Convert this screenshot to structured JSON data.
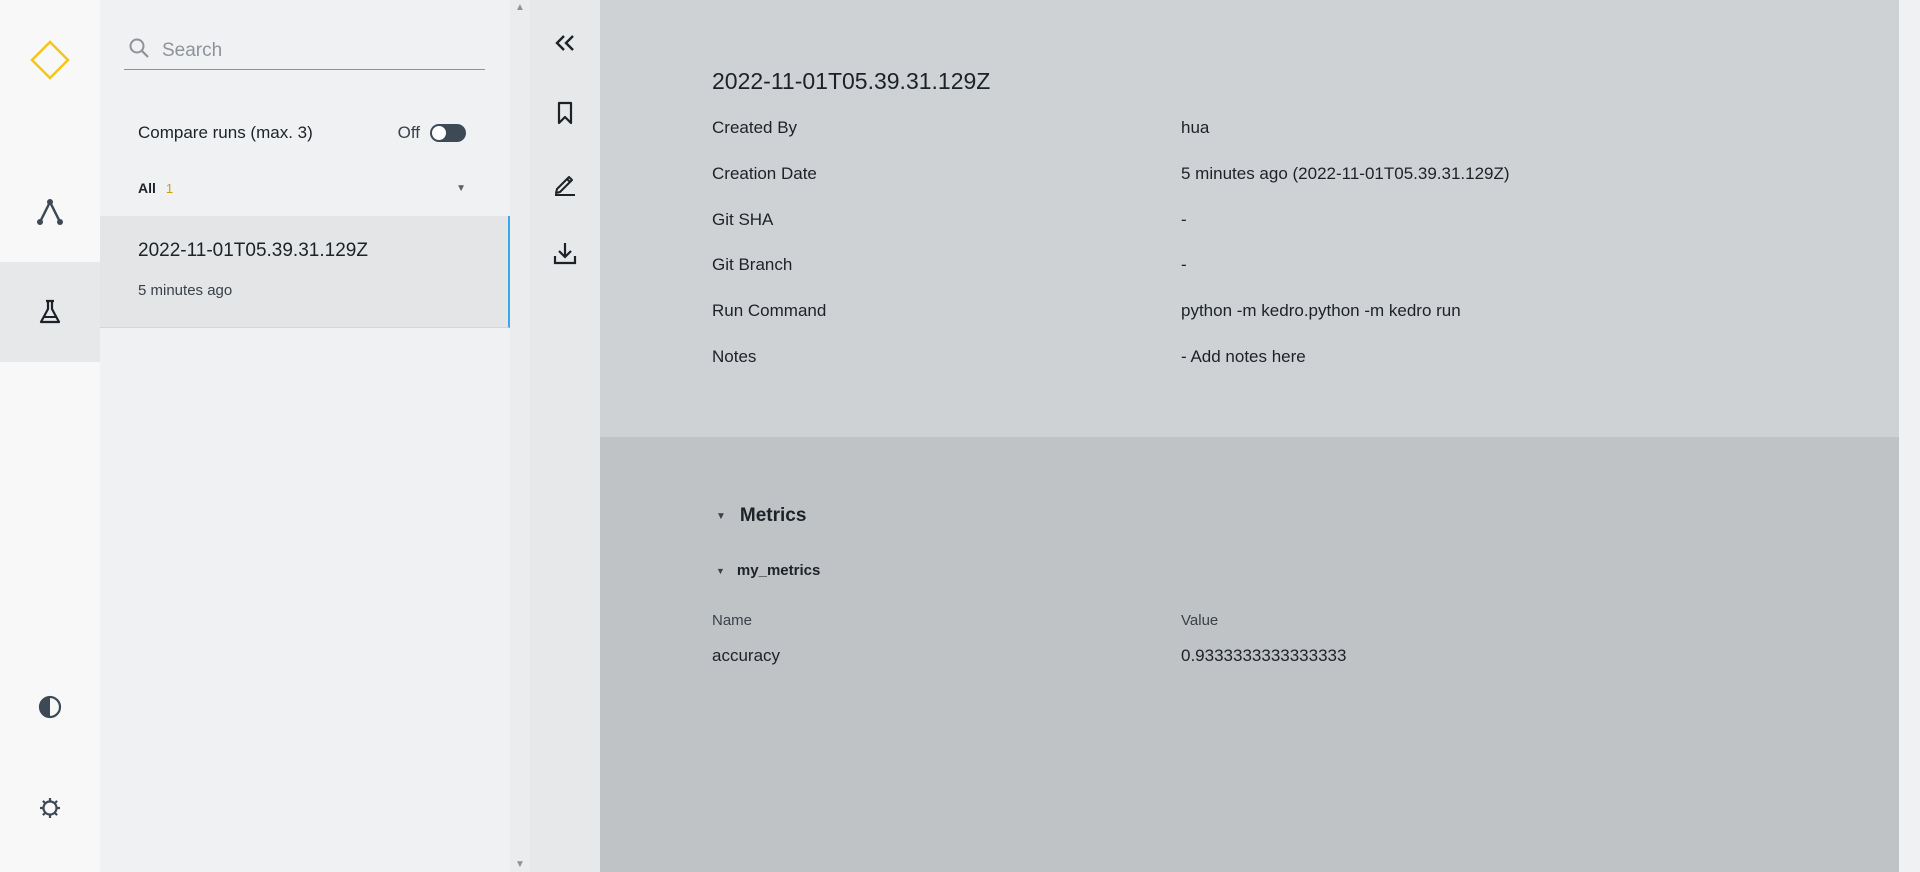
{
  "colors": {
    "logo": "#f5c518",
    "accent_border": "#3aa8e6",
    "filter_count": "#c79e10"
  },
  "global_nav": {
    "icons": [
      "kedro-logo-icon",
      "flowchart-icon",
      "experiment-flask-icon",
      "theme-toggle-icon",
      "settings-gear-icon"
    ]
  },
  "runs_panel": {
    "search": {
      "placeholder": "Search",
      "value": ""
    },
    "compare": {
      "label": "Compare runs (max. 3)",
      "state": "Off"
    },
    "filter": {
      "label": "All",
      "count": "1"
    },
    "runs": [
      {
        "title": "2022-11-01T05.39.31.129Z",
        "time": "5 minutes ago"
      }
    ]
  },
  "toolbar": {
    "icons": [
      "collapse-icon",
      "bookmark-icon",
      "edit-icon",
      "download-icon"
    ]
  },
  "details": {
    "title": "2022-11-01T05.39.31.129Z",
    "rows": [
      {
        "label": "Created By",
        "value": "hua"
      },
      {
        "label": "Creation Date",
        "value": "5 minutes ago (2022-11-01T05.39.31.129Z)"
      },
      {
        "label": "Git SHA",
        "value": "-"
      },
      {
        "label": "Git Branch",
        "value": "-"
      },
      {
        "label": "Run Command",
        "value": "python -m kedro.python -m kedro run"
      },
      {
        "label": "Notes",
        "value": "- Add notes here"
      }
    ]
  },
  "metrics": {
    "title": "Metrics",
    "group": "my_metrics",
    "columns": {
      "name": "Name",
      "value": "Value"
    },
    "rows": [
      {
        "name": "accuracy",
        "value": "0.9333333333333333"
      }
    ]
  }
}
